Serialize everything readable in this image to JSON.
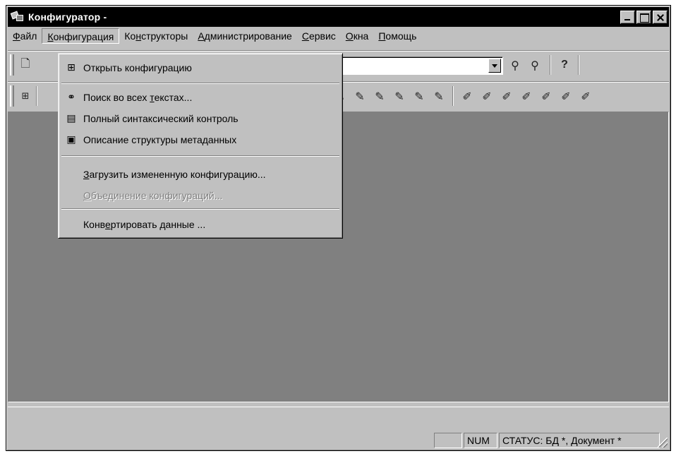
{
  "window": {
    "title": "Конфигуратор -"
  },
  "menubar": {
    "items": [
      {
        "pre": "",
        "u": "Ф",
        "post": "айл"
      },
      {
        "pre": "",
        "u": "К",
        "post": "онфигурация"
      },
      {
        "pre": "Ко",
        "u": "н",
        "post": "структоры"
      },
      {
        "pre": "",
        "u": "А",
        "post": "дминистрирование"
      },
      {
        "pre": "",
        "u": "С",
        "post": "ервис"
      },
      {
        "pre": "",
        "u": "О",
        "post": "кна"
      },
      {
        "pre": "",
        "u": "П",
        "post": "омощь"
      }
    ]
  },
  "dropdown": {
    "items": [
      {
        "icon": "open-config-icon",
        "text": "Открыть конфигурацию"
      },
      {
        "icon": "search-binoculars-icon",
        "pre": "Поиск во всех ",
        "u": "т",
        "post": "екстах..."
      },
      {
        "icon": "syntax-check-icon",
        "text": "Полный синтаксический контроль"
      },
      {
        "icon": "metadata-structure-icon",
        "text": "Описание структуры метаданных"
      },
      {
        "pre": "",
        "u": "З",
        "post": "агрузить измененную конфигурацию..."
      },
      {
        "pre": "",
        "u": "О",
        "post": "бъединение конфигураций..."
      },
      {
        "pre": "Конв",
        "u": "е",
        "post": "ртировать данные ..."
      }
    ]
  },
  "statusbar": {
    "num": "NUM",
    "status": "СТАТУС: БД *, Документ *"
  },
  "icons": {
    "help": "?"
  }
}
